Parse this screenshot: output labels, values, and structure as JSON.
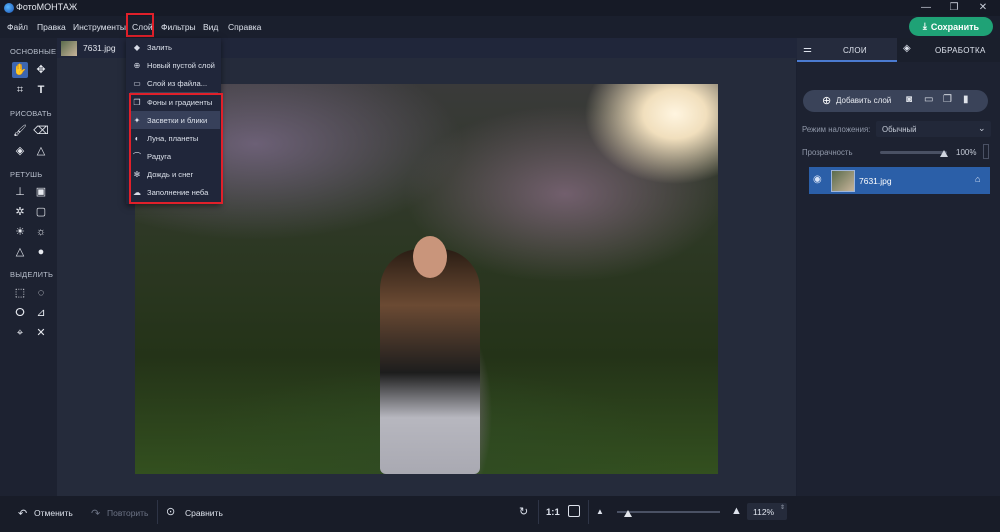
{
  "window": {
    "title": "ФотоМОНТАЖ",
    "controls": [
      "—",
      "❐",
      "✕"
    ]
  },
  "menu": {
    "items": [
      "Файл",
      "Правка",
      "Инструменты",
      "Слой",
      "Фильтры",
      "Вид",
      "Справка"
    ]
  },
  "save_button": {
    "label": "Сохранить",
    "icon": "download-icon"
  },
  "tools": {
    "sections": [
      "ОСНОВНЫЕ",
      "РИСОВАТЬ",
      "РЕТУШЬ",
      "ВЫДЕЛИТЬ"
    ]
  },
  "file_tab": {
    "name": "7631.jpg"
  },
  "dropdown": {
    "items": [
      {
        "label": "Залить",
        "icon": "paint-bucket-icon"
      },
      {
        "label": "Новый пустой слой",
        "icon": "plus-circle-icon"
      },
      {
        "label": "Слой из файла...",
        "icon": "folder-icon"
      },
      {
        "label": "Фоны и градиенты",
        "icon": "layers-icon"
      },
      {
        "label": "Засветки и блики",
        "icon": "sparkle-icon"
      },
      {
        "label": "Луна, планеты",
        "icon": "planet-icon"
      },
      {
        "label": "Радуга",
        "icon": "rainbow-icon"
      },
      {
        "label": "Дождь и снег",
        "icon": "snowflake-icon"
      },
      {
        "label": "Заполнение неба",
        "icon": "cloud-icon"
      }
    ],
    "highlighted": "Засветки и блики"
  },
  "right_panel": {
    "tabs": [
      "СЛОИ",
      "ОБРАБОТКА"
    ],
    "add_layer_label": "Добавить слой",
    "blend_mode_label": "Режим наложения:",
    "blend_mode_value": "Обычный",
    "opacity_label": "Прозрачность",
    "opacity_value": "100%",
    "opacity_fraction": 1.0,
    "layer_name": "7631.jpg"
  },
  "bottom_bar": {
    "undo_label": "Отменить",
    "redo_label": "Повторить",
    "compare_label": "Сравнить",
    "ratio_label": "1:1",
    "zoom_value": "112%",
    "zoom_fraction": 0.1
  },
  "colors": {
    "accent": "#1fa276",
    "selection": "#2b5fa8",
    "highlight_box": "#e0202a"
  }
}
